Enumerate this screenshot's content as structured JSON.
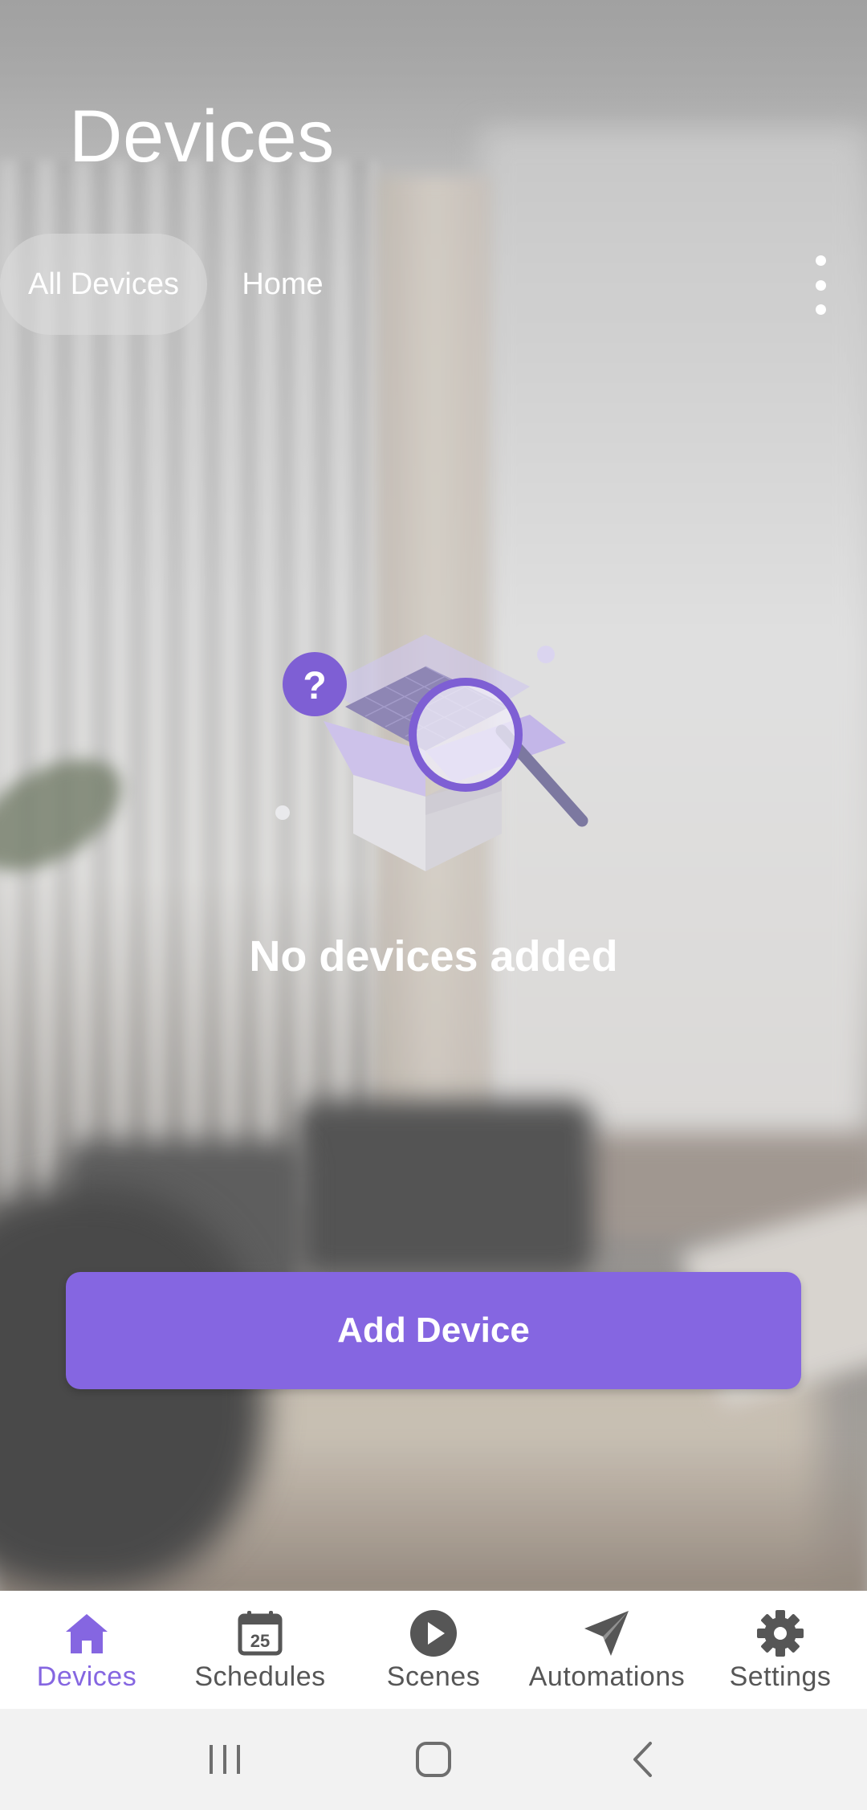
{
  "header": {
    "title": "Devices"
  },
  "filters": {
    "chips": [
      {
        "label": "All Devices",
        "active": true
      },
      {
        "label": "Home",
        "active": false
      }
    ],
    "more_icon": "more-vert-icon"
  },
  "empty_state": {
    "illustration": "open-box-search-illustration",
    "message": "No devices added"
  },
  "actions": {
    "add_device_label": "Add Device"
  },
  "bottom_nav": {
    "items": [
      {
        "label": "Devices",
        "icon": "home-icon",
        "active": true
      },
      {
        "label": "Schedules",
        "icon": "calendar-icon",
        "badge": "25",
        "active": false
      },
      {
        "label": "Scenes",
        "icon": "play-circle-icon",
        "active": false
      },
      {
        "label": "Automations",
        "icon": "send-icon",
        "active": false
      },
      {
        "label": "Settings",
        "icon": "gear-icon",
        "active": false
      }
    ]
  },
  "system_nav": {
    "recents": "recents-icon",
    "home": "home-square-icon",
    "back": "back-icon"
  },
  "colors": {
    "accent": "#8566e1",
    "nav_inactive": "#565656",
    "nav_bg": "#ffffff",
    "system_bar": "#f2f2f2"
  }
}
